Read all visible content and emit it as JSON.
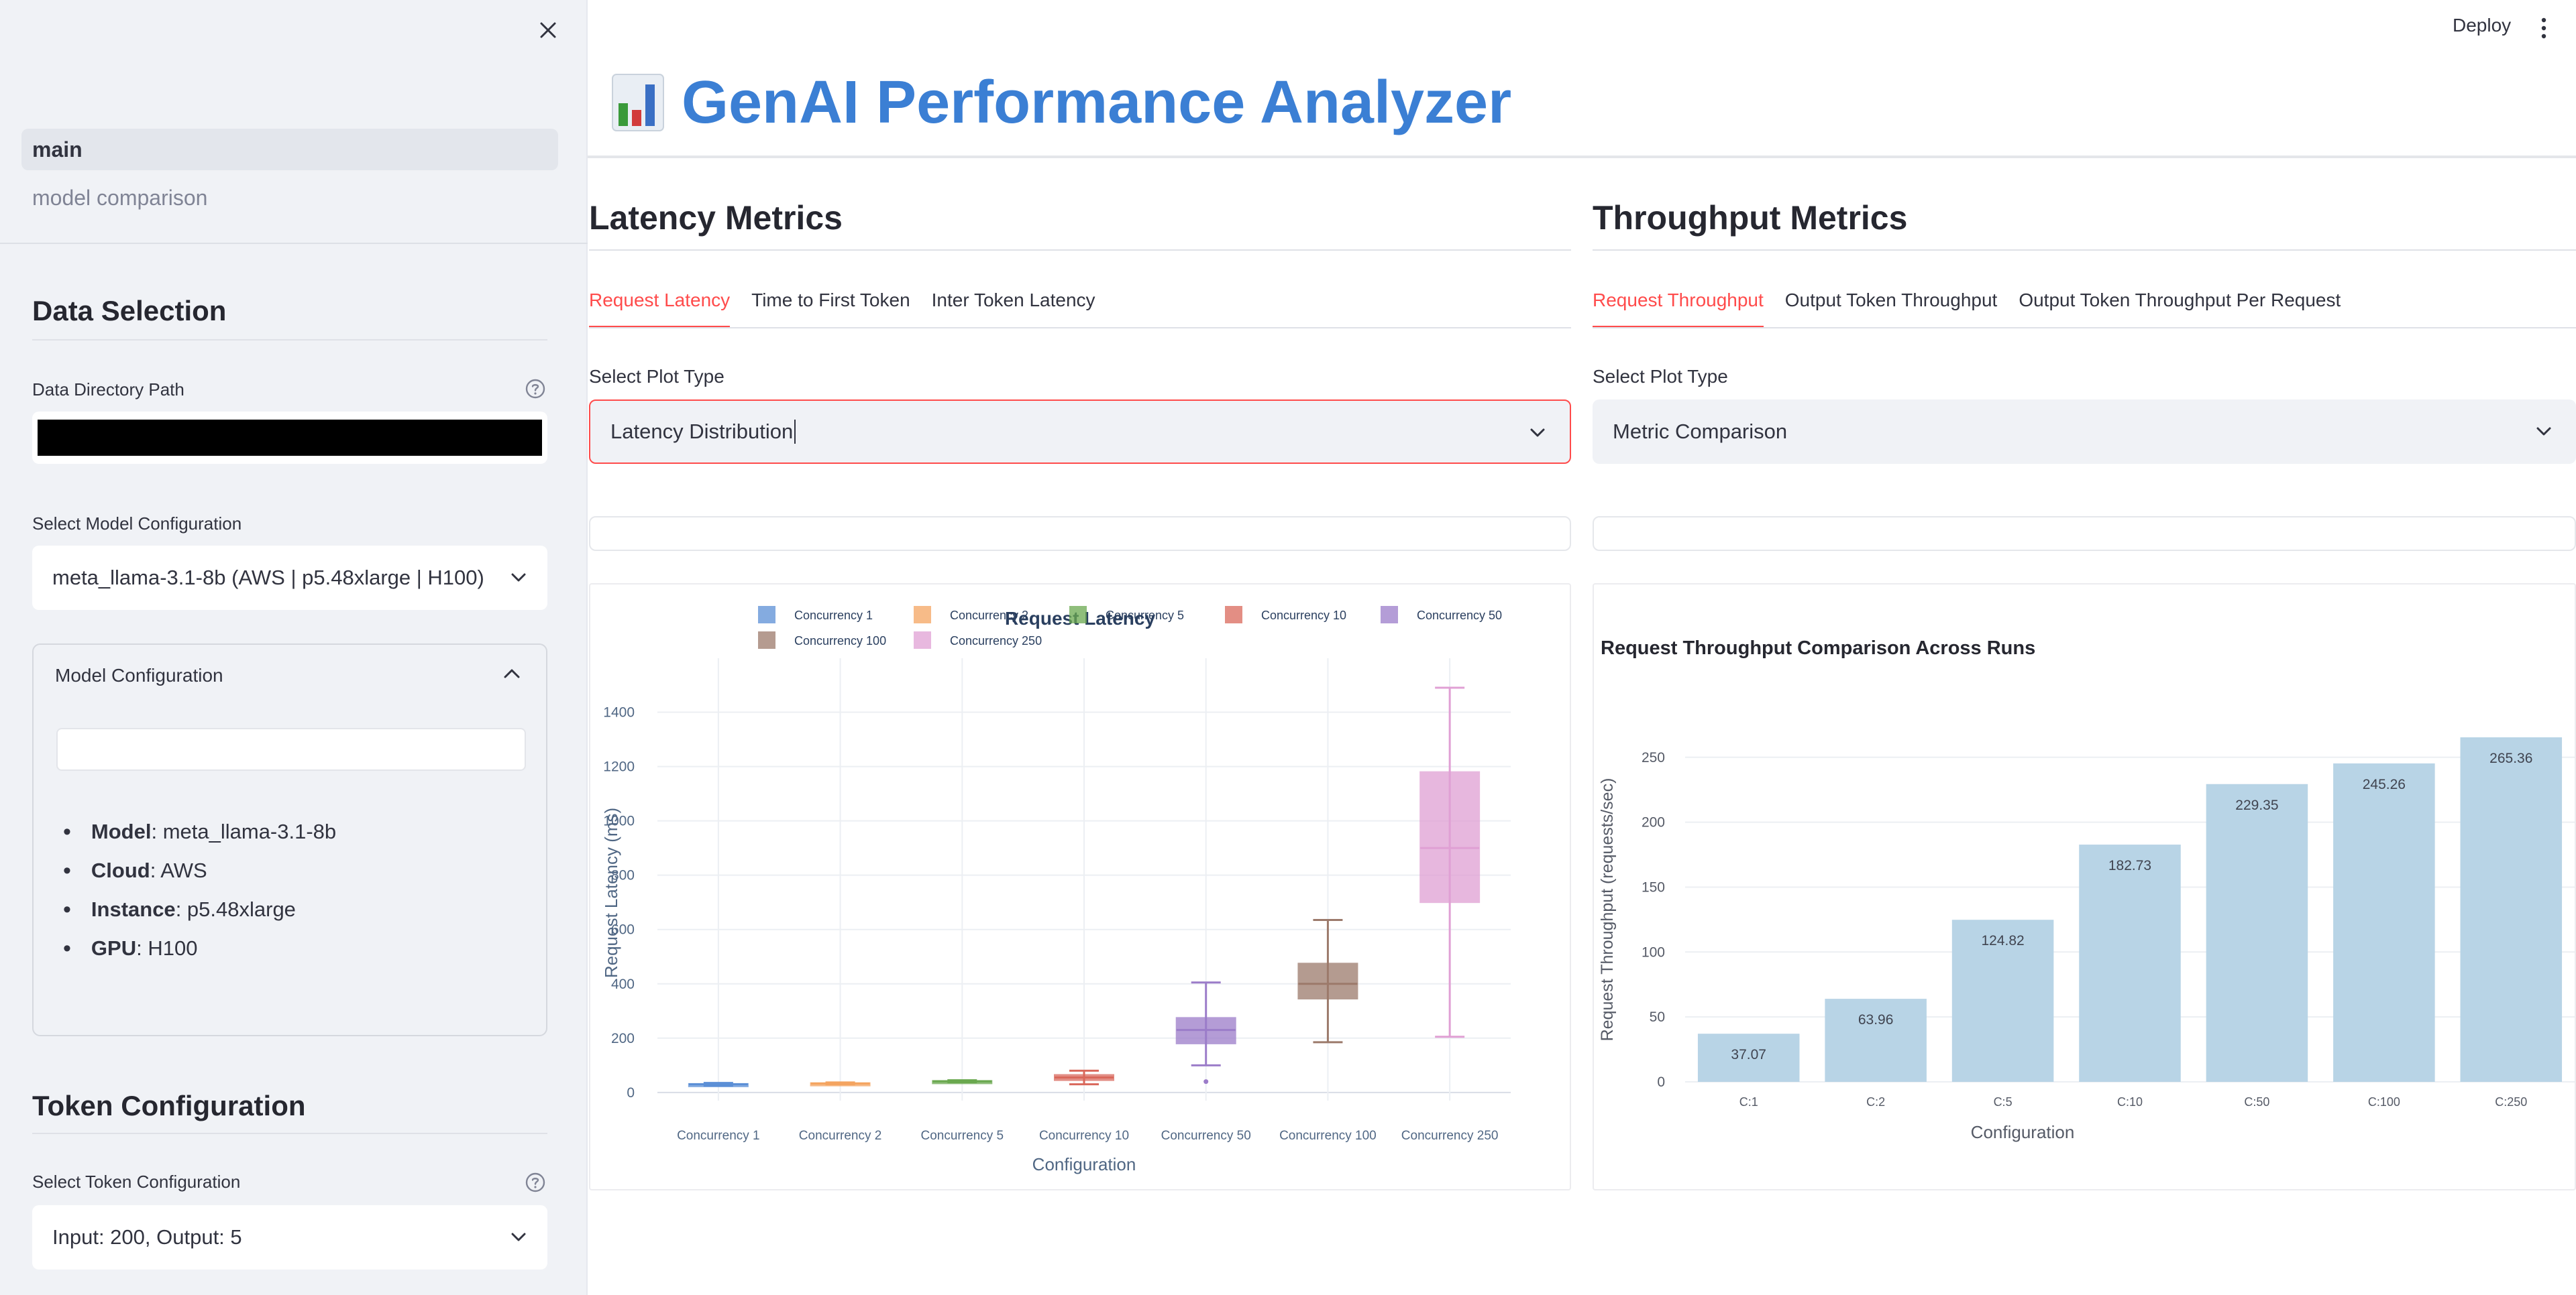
{
  "sidebar": {
    "nav": [
      {
        "label": "main",
        "active": true
      },
      {
        "label": "model comparison",
        "active": false
      }
    ],
    "data_selection": {
      "title": "Data Selection",
      "dir_label": "Data Directory Path"
    },
    "model": {
      "label": "Select Model Configuration",
      "selected": "meta_llama-3.1-8b (AWS | p5.48xlarge | H100)",
      "expander_title": "Model Configuration",
      "details": [
        {
          "key": "Model",
          "value": ": meta_llama-3.1-8b"
        },
        {
          "key": "Cloud",
          "value": ": AWS"
        },
        {
          "key": "Instance",
          "value": ": p5.48xlarge"
        },
        {
          "key": "GPU",
          "value": ": H100"
        }
      ]
    },
    "token": {
      "title": "Token Configuration",
      "label": "Select Token Configuration",
      "selected": "Input: 200, Output: 5"
    }
  },
  "header": {
    "deploy_label": "Deploy",
    "title": "GenAI Performance Analyzer"
  },
  "latency": {
    "title": "Latency Metrics",
    "tabs": [
      "Request Latency",
      "Time to First Token",
      "Inter Token Latency"
    ],
    "plot_type_label": "Select Plot Type",
    "plot_type_value": "Latency Distribution"
  },
  "throughput": {
    "title": "Throughput Metrics",
    "tabs": [
      "Request Throughput",
      "Output Token Throughput",
      "Output Token Throughput Per Request"
    ],
    "plot_type_label": "Select Plot Type",
    "plot_type_value": "Metric Comparison"
  },
  "colors": {
    "accent": "#ff4b4b",
    "title_blue": "#3b7fd4",
    "bar": "#b8d4e6"
  },
  "chart_data": [
    {
      "type": "box",
      "title": "Request Latency",
      "xlabel": "Configuration",
      "ylabel": "Request Latency (ms)",
      "ylim": [
        -30,
        1500
      ],
      "yticks": [
        0,
        200,
        400,
        600,
        800,
        1000,
        1200,
        1400
      ],
      "grid": true,
      "legend_position": "top",
      "series": [
        {
          "name": "Concurrency 1",
          "color": "#5b8fd6",
          "min": 25,
          "q1": 28,
          "median": 30,
          "q3": 32,
          "max": 35
        },
        {
          "name": "Concurrency 2",
          "color": "#f4a460",
          "min": 30,
          "q1": 32,
          "median": 33,
          "q3": 35,
          "max": 37
        },
        {
          "name": "Concurrency 5",
          "color": "#6aa84f",
          "min": 38,
          "q1": 40,
          "median": 41,
          "q3": 43,
          "max": 45
        },
        {
          "name": "Concurrency 10",
          "color": "#d9685b",
          "min": 30,
          "q1": 45,
          "median": 55,
          "q3": 65,
          "max": 80
        },
        {
          "name": "Concurrency 50",
          "color": "#9b7cc9",
          "min": 100,
          "q1": 180,
          "median": 230,
          "q3": 275,
          "max": 405,
          "outliers": [
            40
          ]
        },
        {
          "name": "Concurrency 100",
          "color": "#9c7a6b",
          "min": 185,
          "q1": 345,
          "median": 400,
          "q3": 475,
          "max": 635
        },
        {
          "name": "Concurrency 250",
          "color": "#e0a0d4",
          "min": 205,
          "q1": 700,
          "median": 900,
          "q3": 1180,
          "max": 1490
        }
      ]
    },
    {
      "type": "bar",
      "title": "Request Throughput Comparison Across Runs",
      "xlabel": "Configuration",
      "ylabel": "Request Throughput (requests/sec)",
      "ylim": [
        0,
        265.36
      ],
      "yticks": [
        0,
        50,
        100,
        150,
        200,
        250
      ],
      "grid": true,
      "categories": [
        "C:1",
        "C:2",
        "C:5",
        "C:10",
        "C:50",
        "C:100",
        "C:250"
      ],
      "values": [
        37.07,
        63.96,
        124.82,
        182.73,
        229.35,
        245.26,
        265.36
      ]
    }
  ]
}
